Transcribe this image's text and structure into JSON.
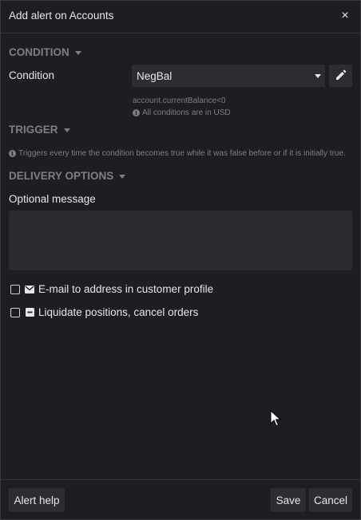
{
  "dialog": {
    "title": "Add alert on Accounts",
    "close_glyph": "×"
  },
  "condition_section": {
    "heading": "CONDITION",
    "label": "Condition",
    "selected_value": "NegBal",
    "expression": "account.currentBalance<0",
    "currency_note": "All conditions are in USD"
  },
  "trigger_section": {
    "heading": "TRIGGER",
    "note": "Triggers every time the condition becomes true while it was false before or if it is initially true."
  },
  "delivery_section": {
    "heading": "DELIVERY OPTIONS",
    "message_label": "Optional message",
    "message_value": "",
    "options": [
      {
        "label": "E-mail to address in customer profile",
        "icon": "envelope-icon",
        "checked": false
      },
      {
        "label": "Liquidate positions, cancel orders",
        "icon": "minus-square-icon",
        "checked": false
      }
    ]
  },
  "footer": {
    "help_label": "Alert help",
    "save_label": "Save",
    "cancel_label": "Cancel"
  },
  "colors": {
    "background": "#1e1e22",
    "section_heading": "#7d7d88",
    "control": "#2c2c31",
    "text": "#e6e6ea"
  }
}
